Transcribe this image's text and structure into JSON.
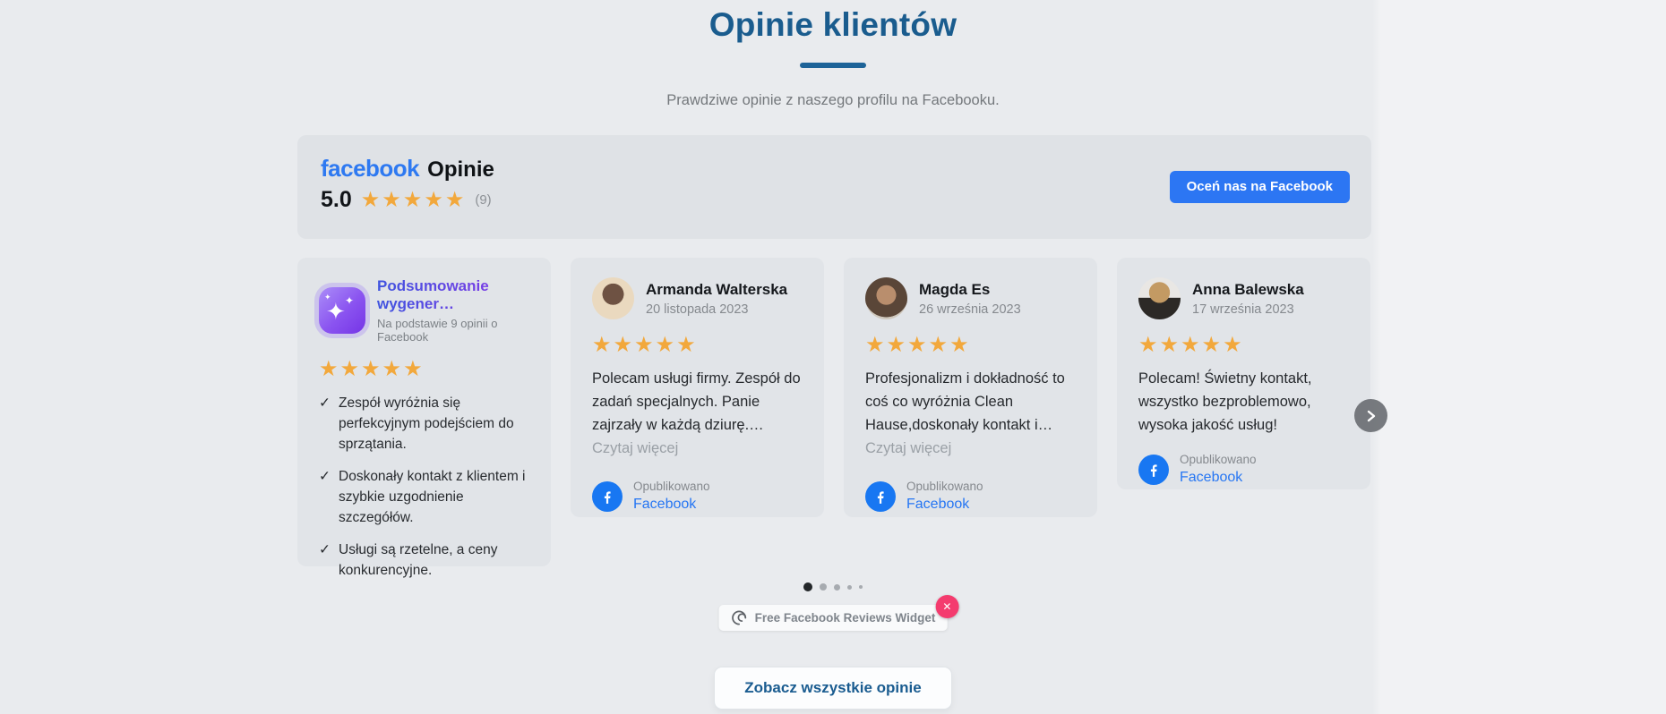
{
  "page": {
    "title": "Opinie klientów",
    "subtitle": "Prawdziwe opinie z naszego profilu na Facebooku."
  },
  "header": {
    "brand": "facebook",
    "section_label": "Opinie",
    "rating_value": "5.0",
    "rating_stars": "★★★★★",
    "review_count": "(9)",
    "cta_label": "Oceń nas na Facebook"
  },
  "summary_card": {
    "title": "Podsumowanie wygener…",
    "subtitle": "Na podstawie 9 opinii o Facebook",
    "stars": "★★★★★",
    "bullets": [
      "Zespół wyróżnia się perfekcyjnym podejściem do sprzątania.",
      "Doskonały kontakt z klientem i szybkie uzgodnienie szczegółów.",
      "Usługi są rzetelne, a ceny konkurencyjne."
    ]
  },
  "reviews": [
    {
      "name": "Armanda Walterska",
      "date": "20 listopada 2023",
      "stars": "★★★★★",
      "text": "Polecam usługi firmy. Zespół do zadań specjalnych. Panie zajrzały w każdą dziurę.…",
      "read_more": "Czytaj więcej",
      "published_label": "Opublikowano",
      "source_label": "Facebook"
    },
    {
      "name": "Magda Es",
      "date": "26 września 2023",
      "stars": "★★★★★",
      "text": "Profesjonalizm i dokładność to coś co wyróżnia Clean Hause,doskonały kontakt i…",
      "read_more": "Czytaj więcej",
      "published_label": "Opublikowano",
      "source_label": "Facebook"
    },
    {
      "name": "Anna Balewska",
      "date": "17 września 2023",
      "stars": "★★★★★",
      "text": "Polecam! Świetny kontakt, wszystko bezproblemowo, wysoka jakość usług!",
      "published_label": "Opublikowano",
      "source_label": "Facebook"
    }
  ],
  "carousel": {
    "dot_count": 5,
    "active_index": 0
  },
  "badge": {
    "label": "Free Facebook Reviews Widget"
  },
  "footer": {
    "see_all_label": "Zobacz wszystkie opinie"
  },
  "colors": {
    "heading_blue": "#1a5c8e",
    "facebook_blue": "#1877f2",
    "star_orange": "#f2a83c",
    "cta_blue": "#2c76f3",
    "link_blue": "#2676f3",
    "close_pink": "#f43b6e"
  }
}
